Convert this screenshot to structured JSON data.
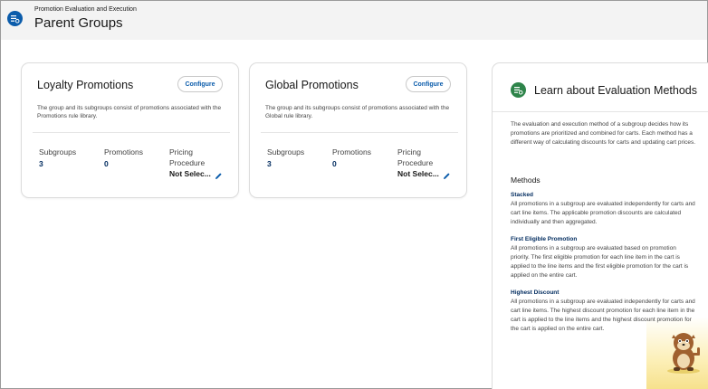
{
  "header": {
    "eyebrow": "Promotion Evaluation and Execution",
    "title": "Parent Groups"
  },
  "cards": [
    {
      "title": "Loyalty Promotions",
      "configure_label": "Configure",
      "description": "The group and its subgroups consist of promotions associated with the Promotions rule library.",
      "subgroups_label": "Subgroups",
      "subgroups_value": "3",
      "promotions_label": "Promotions",
      "promotions_value": "0",
      "pricing_label": "Pricing Procedure",
      "pricing_value": "Not Selec..."
    },
    {
      "title": "Global Promotions",
      "configure_label": "Configure",
      "description": "The group and its subgroups consist of promotions associated with the Global rule library.",
      "subgroups_label": "Subgroups",
      "subgroups_value": "3",
      "promotions_label": "Promotions",
      "promotions_value": "0",
      "pricing_label": "Pricing Procedure",
      "pricing_value": "Not Selec..."
    }
  ],
  "side_panel": {
    "title": "Learn about Evaluation Methods",
    "intro": "The evaluation and execution method of a subgroup decides how its promotions are prioritized and combined for carts. Each method has a different way of calculating discounts for carts and updating cart prices.",
    "methods_heading": "Methods",
    "methods": [
      {
        "name": "Stacked",
        "description": "All promotions in a subgroup are evaluated independently for carts and cart line items. The applicable promotion discounts are calculated individually and then aggregated."
      },
      {
        "name": "First Eligible Promotion",
        "description": "All promotions in a subgroup are evaluated based on promotion priority. The first eligible promotion for each line item in the cart is applied to the line items and the first eligible promotion for the cart is applied on the entire cart."
      },
      {
        "name": "Highest Discount",
        "description": "All promotions in a subgroup are evaluated independently for carts and cart line items. The highest discount promotion for each line item in the cart is applied to the line items and the highest discount promotion for the cart is applied on the entire cart."
      }
    ]
  },
  "icons": {
    "header": "list-settings-icon",
    "side_panel": "list-settings-icon",
    "edit": "pencil-edit-icon",
    "mascot": "astro-mascot-illustration"
  },
  "colors": {
    "brand_blue": "#0b5cab",
    "dark_blue": "#032d60",
    "green": "#2e844a"
  }
}
